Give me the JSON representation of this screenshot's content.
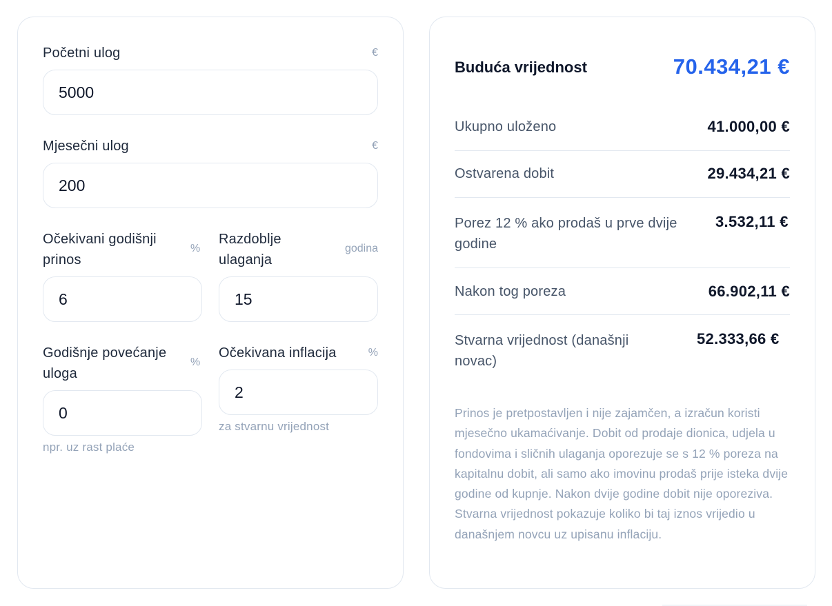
{
  "inputs": {
    "initial": {
      "label": "Početni ulog",
      "unit": "€",
      "value": "5000"
    },
    "monthly": {
      "label": "Mjesečni ulog",
      "unit": "€",
      "value": "200"
    },
    "return_rate": {
      "label": "Očekivani godišnji prinos",
      "unit": "%",
      "value": "6"
    },
    "period": {
      "label": "Razdoblje ulaganja",
      "unit": "godina",
      "value": "15"
    },
    "annual_increase": {
      "label": "Godišnje povećanje uloga",
      "unit": "%",
      "value": "0",
      "hint": "npr. uz rast plaće"
    },
    "inflation": {
      "label": "Očekivana inflacija",
      "unit": "%",
      "value": "2",
      "hint": "za stvarnu vrijednost"
    }
  },
  "results": {
    "future_value": {
      "label": "Buduća vrijednost",
      "value": "70.434,21 €"
    },
    "total_invested": {
      "label": "Ukupno uloženo",
      "value": "41.000,00 €"
    },
    "profit": {
      "label": "Ostvarena dobit",
      "value": "29.434,21 €"
    },
    "tax": {
      "label": "Porez 12 % ako prodaš u prve dvije godine",
      "value": "3.532,11 €"
    },
    "after_tax": {
      "label": "Nakon tog poreza",
      "value": "66.902,11 €"
    },
    "real_value": {
      "label": "Stvarna vrijednost (današnji novac)",
      "value": "52.333,66 €"
    }
  },
  "note": "Prinos je pretpostavljen i nije zajamčen, a izračun koristi mjesečno ukamaćivanje. Dobit od prodaje dionica, udjela u fondovima i sličnih ulaganja oporezuje se s 12 % poreza na kapitalnu dobit, ali samo ako imovinu prodaš prije isteka dvije godine od kupnje. Nakon dvije godine dobit nije oporeziva. Stvarna vrijednost pokazuje koliko bi taj iznos vrijedio u današnjem novcu uz upisanu inflaciju.",
  "colors": {
    "accent": "#2563eb",
    "muted": "#94a3b8",
    "border": "#e2e8f0"
  }
}
